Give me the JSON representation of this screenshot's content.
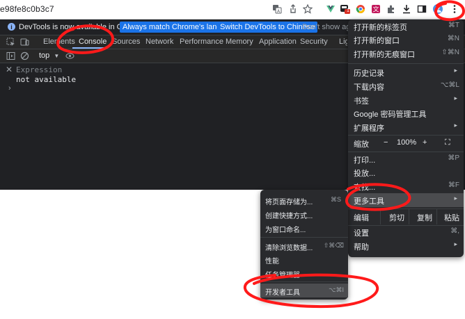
{
  "browser": {
    "url_fragment": "e98fe8c0b3c7",
    "toolbar_icons": [
      "translate-icon",
      "share-icon",
      "bookmark-star-icon",
      "vue-devtools-extension-icon",
      "extension-badge-icon",
      "chrome-circle-extension-icon",
      "translate-extension-icon",
      "puzzle-extensions-icon",
      "download-icon",
      "side-panel-icon",
      "profile-avatar-icon",
      "kebab-menu-icon"
    ],
    "extension_badge": "1"
  },
  "devtools": {
    "infobar": {
      "text": "DevTools is now available in Chinese!",
      "match_button": "Always match Chrome's language",
      "switch_button": "Switch DevTools to Chinese",
      "dismiss": "Don't show again"
    },
    "tabs": [
      "Elements",
      "Console",
      "Sources",
      "Network",
      "Performance",
      "Memory",
      "Application",
      "Security",
      "Lighthouse"
    ],
    "active_tab": "Console",
    "context": "top",
    "expression": {
      "label": "Expression",
      "value": "not available"
    },
    "prompt": "›"
  },
  "main_menu": {
    "items": [
      {
        "label": "打开新的标签页",
        "shortcut": "⌘T"
      },
      {
        "label": "打开新的窗口",
        "shortcut": "⌘N"
      },
      {
        "label": "打开新的无痕窗口",
        "shortcut": "⇧⌘N"
      },
      {
        "label": "历史记录",
        "arrow": "▸"
      },
      {
        "label": "下载内容",
        "shortcut": "⌥⌘L"
      },
      {
        "label": "书签",
        "arrow": "▸"
      },
      {
        "label": "Google 密码管理工具"
      },
      {
        "label": "扩展程序",
        "arrow": "▸"
      },
      {
        "label": "打印...",
        "shortcut": "⌘P"
      },
      {
        "label": "投放..."
      },
      {
        "label": "查找...",
        "shortcut": "⌘F"
      },
      {
        "label": "更多工具",
        "arrow": "▸"
      },
      {
        "label": "设置",
        "shortcut": "⌘,"
      },
      {
        "label": "帮助",
        "arrow": "▸"
      }
    ],
    "zoom": {
      "label": "缩放",
      "minus": "−",
      "value": "100%",
      "plus": "+",
      "fullscreen": "⛶"
    },
    "edit": {
      "label": "编辑",
      "cut": "剪切",
      "copy": "复制",
      "paste": "粘贴"
    }
  },
  "more_tools_menu": {
    "items": [
      {
        "label": "将页面存储为...",
        "shortcut": "⌘S"
      },
      {
        "label": "创建快捷方式..."
      },
      {
        "label": "为窗口命名..."
      },
      {
        "label": "清除浏览数据...",
        "shortcut": "⇧⌘⌫"
      },
      {
        "label": "性能"
      },
      {
        "label": "任务管理器"
      },
      {
        "label": "开发者工具",
        "shortcut": "⌥⌘I"
      }
    ]
  },
  "colors": {
    "annotation_red": "#ff1a1a",
    "menu_bg": "#292a2d",
    "devtools_bg": "#202124",
    "accent_blue": "#1a73e8"
  }
}
